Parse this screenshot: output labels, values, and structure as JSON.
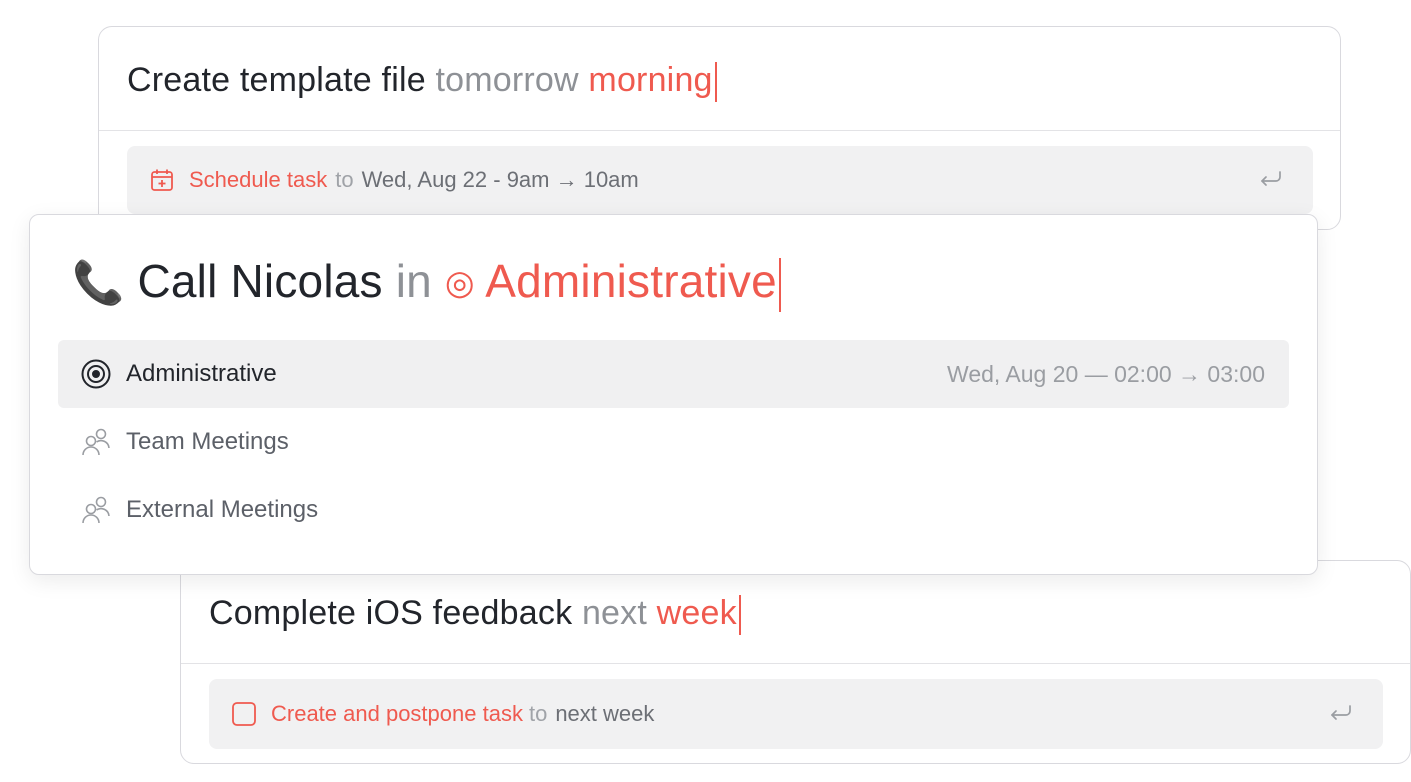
{
  "card1": {
    "command": {
      "main": "Create template file",
      "muted": "tomorrow",
      "highlight": "morning"
    },
    "suggestion": {
      "action": "Schedule task",
      "connector": "to",
      "target": "Wed, Aug 22 - 9am → 10am",
      "icon": "calendar-plus-icon",
      "enter_icon": "enter-return-icon"
    }
  },
  "card2": {
    "command": {
      "emoji": "📞",
      "main": "Call Nicolas",
      "muted": "in",
      "tag_icon": "◎",
      "highlight": "Administrative"
    },
    "options": [
      {
        "label": "Administrative",
        "icon": "target-icon",
        "time": "Wed, Aug 20 — 02:00 → 03:00",
        "selected": true
      },
      {
        "label": "Team Meetings",
        "icon": "people-icon",
        "time": "",
        "selected": false
      },
      {
        "label": "External Meetings",
        "icon": "people-icon",
        "time": "",
        "selected": false
      }
    ]
  },
  "card3": {
    "command": {
      "main": "Complete iOS feedback",
      "muted": "next",
      "highlight": "week"
    },
    "suggestion": {
      "action": "Create and postpone task",
      "connector": "to",
      "target": "next week",
      "icon": "checkbox-icon",
      "enter_icon": "enter-return-icon"
    }
  },
  "colors": {
    "accent": "#ef5a4f",
    "muted": "#8e9196",
    "text": "#22252b",
    "suggestion_bg": "#f1f1f2"
  }
}
